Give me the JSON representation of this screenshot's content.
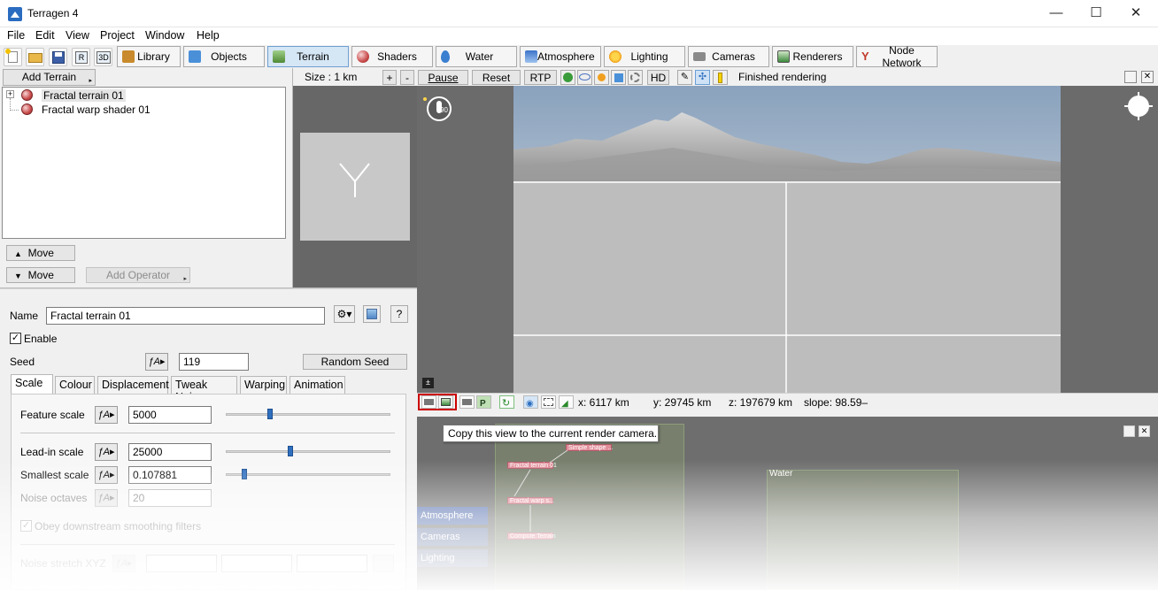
{
  "app": {
    "title": "Terragen 4"
  },
  "window": {
    "minimize": "—",
    "maximize": "☐",
    "close": "✕"
  },
  "menu": [
    "File",
    "Edit",
    "View",
    "Project",
    "Window",
    "Help"
  ],
  "toolbar": {
    "tabs": [
      {
        "label": "Library",
        "icon": "library-icon",
        "color": "#c88a2c"
      },
      {
        "label": "Objects",
        "icon": "objects-icon",
        "color": "#4a90d9"
      },
      {
        "label": "Terrain",
        "icon": "terrain-icon",
        "color": "#5a9a3a"
      },
      {
        "label": "Shaders",
        "icon": "shaders-icon",
        "color": "#c94b4b"
      },
      {
        "label": "Water",
        "icon": "water-icon",
        "color": "#3b7fd0"
      },
      {
        "label": "Atmosphere",
        "icon": "atmosphere-icon",
        "color": "#3c73c9"
      },
      {
        "label": "Lighting",
        "icon": "lighting-icon",
        "color": "#f0a020"
      },
      {
        "label": "Cameras",
        "icon": "cameras-icon",
        "color": "#7a7a7a"
      },
      {
        "label": "Renderers",
        "icon": "renderers-icon",
        "color": "#3c8a3c"
      },
      {
        "label": "Node Network",
        "icon": "node-network-icon",
        "color": "#c0392b"
      }
    ]
  },
  "left": {
    "add_terrain": "Add Terrain",
    "tree": [
      "Fractal terrain 01",
      "Fractal warp shader 01"
    ],
    "move_up": "Move",
    "move_down": "Move",
    "add_operator": "Add Operator"
  },
  "viewport_bar": {
    "size": "Size : 1 km",
    "plus": "+",
    "minus": "-",
    "pause": "Pause",
    "reset": "Reset",
    "rtp": "RTP",
    "hd": "HD",
    "status": "Finished rendering"
  },
  "statusbar": {
    "x": "x: 6117 km",
    "y": "y: 29745 km",
    "z": "z: 197679 km",
    "slope": "slope: 98.59–"
  },
  "tooltip": "Copy this view to the current render camera.",
  "props": {
    "name_label": "Name",
    "name_value": "Fractal terrain 01",
    "help": "?",
    "enable": "Enable",
    "seed_label": "Seed",
    "seed_value": "119",
    "random_seed": "Random Seed",
    "tabs": [
      "Scale",
      "Colour",
      "Displacement",
      "Tweak Noise",
      "Warping",
      "Animation"
    ],
    "rows": [
      {
        "label": "Feature scale",
        "value": "5000",
        "level": 0.33
      },
      {
        "label": "Lead-in scale",
        "value": "25000",
        "level": 0.39
      },
      {
        "label": "Smallest scale",
        "value": "0.107881",
        "level": 0.1
      },
      {
        "label": "Noise octaves",
        "value": "20",
        "level": null
      }
    ],
    "obey": "Obey downstream smoothing filters",
    "noise_stretch": "Noise stretch XYZ"
  },
  "nodes": {
    "water_group": "Water",
    "fractal_terrain": "Fractal terrain 01",
    "simple_shape": "Simple shape ...",
    "fractal_warp": "Fractal warp s...",
    "compute_terrain": "Compute Terrain",
    "side": [
      "Atmosphere",
      "Cameras",
      "Lighting"
    ]
  },
  "colors": {
    "accent": "#d6e7f5",
    "sky": "#8fa6bf",
    "selection": "#cc0000"
  }
}
